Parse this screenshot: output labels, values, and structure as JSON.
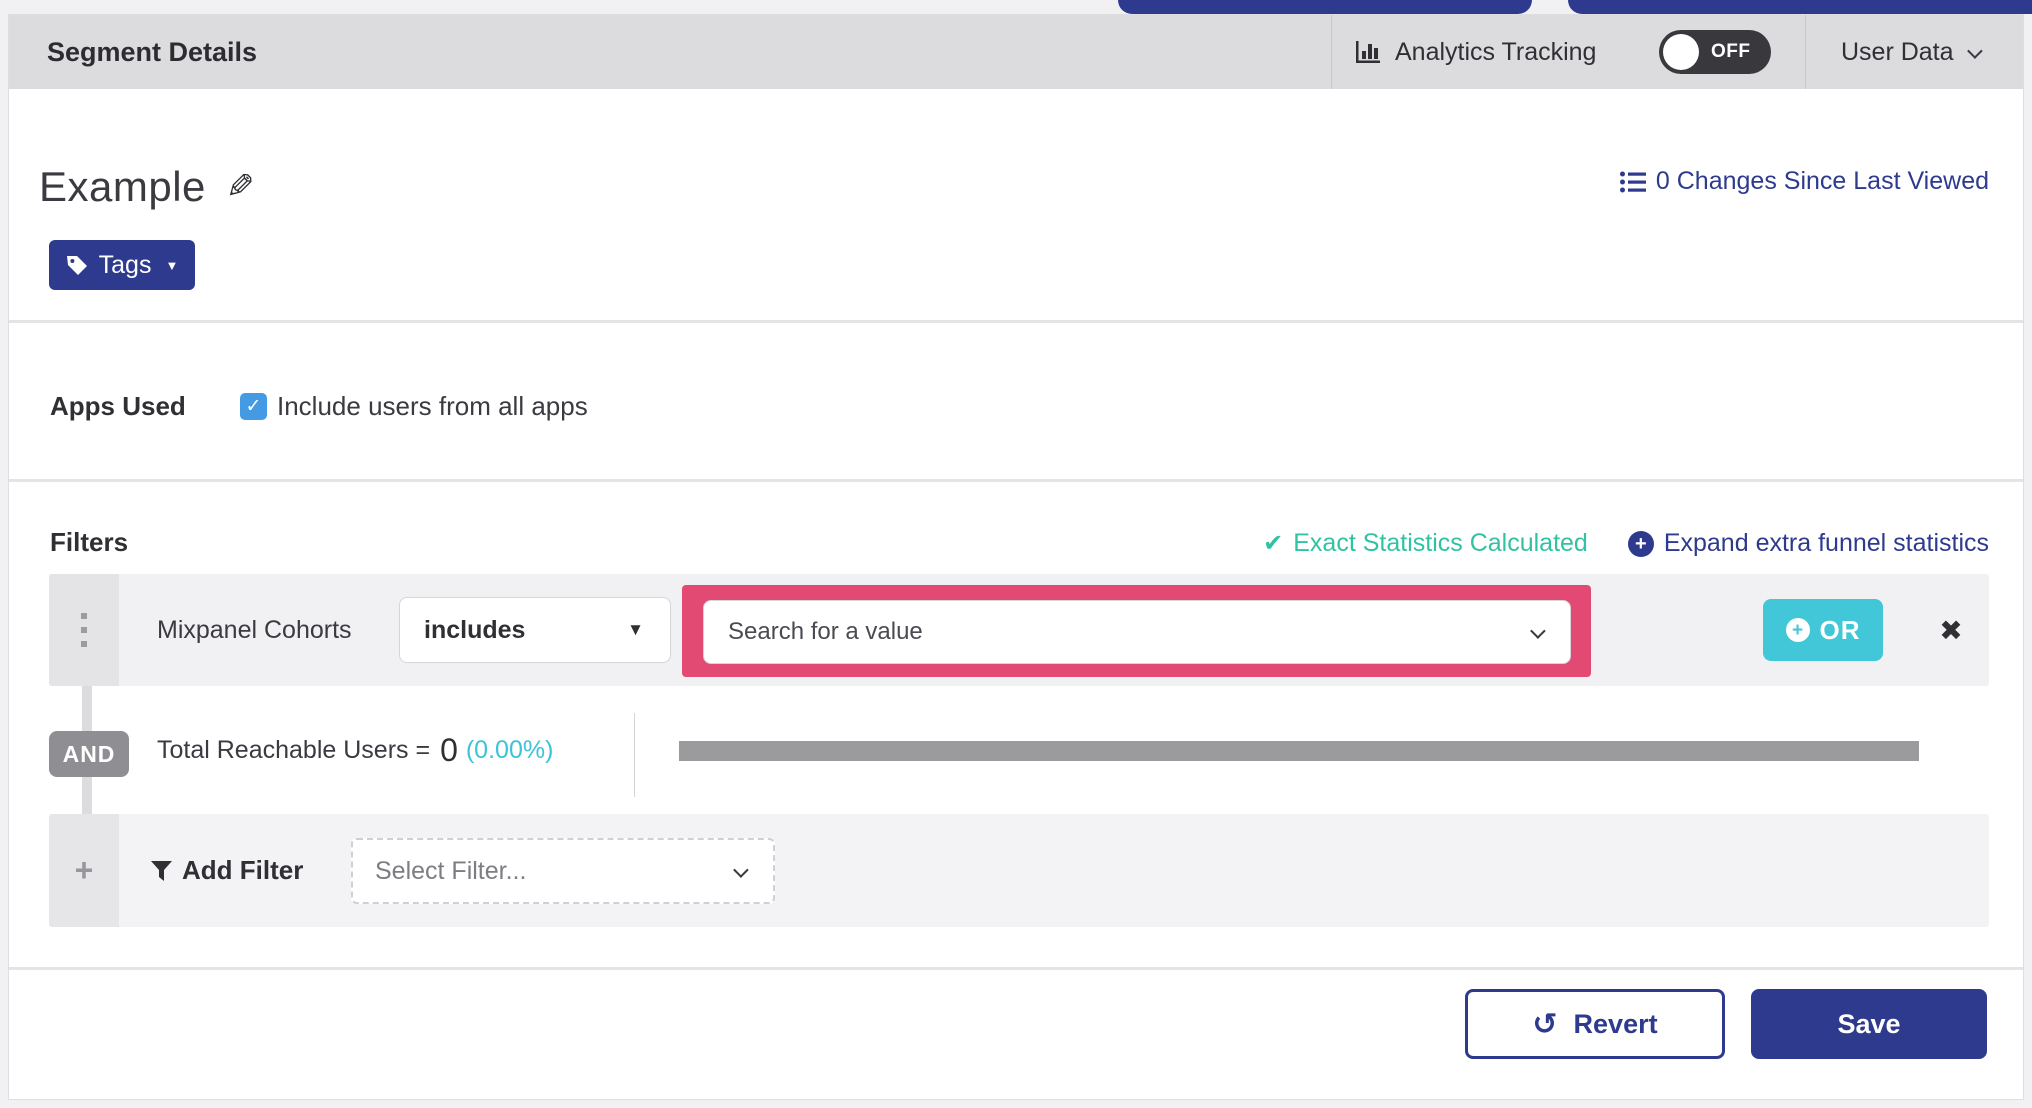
{
  "header": {
    "title": "Segment Details",
    "analytics_tracking_label": "Analytics Tracking",
    "toggle_state": "OFF",
    "user_data_label": "User Data"
  },
  "title_section": {
    "segment_name": "Example",
    "changes_link": "0 Changes Since Last Viewed",
    "tags_label": "Tags"
  },
  "apps_used": {
    "label": "Apps Used",
    "checkbox_label": "Include users from all apps",
    "checked": true
  },
  "filters": {
    "heading": "Filters",
    "exact_stats_label": "Exact Statistics Calculated",
    "expand_link_label": "Expand extra funnel statistics",
    "row1": {
      "filter_name": "Mixpanel Cohorts",
      "operator_value": "includes",
      "value_placeholder": "Search for a value",
      "or_label": "OR",
      "close_glyph": "✖"
    },
    "connector_label": "AND",
    "stats": {
      "label": "Total Reachable Users =",
      "value": "0",
      "percent": "(0.00%)"
    },
    "add_filter": {
      "plus_glyph": "+",
      "label": "Add Filter",
      "select_placeholder": "Select Filter..."
    }
  },
  "footer": {
    "revert_label": "Revert",
    "revert_icon_glyph": "↺",
    "save_label": "Save"
  },
  "glyphs": {
    "pencil": "✎",
    "check": "✓",
    "heavy_check": "✔",
    "solid_caret": "▼",
    "plus": "+"
  },
  "colors": {
    "accent_navy": "#2d3a8e",
    "teal_success": "#2fc3a3",
    "cyan": "#3bc4d8",
    "or_button": "#41c7d8",
    "highlight_pink": "#e24a73",
    "toggle_off_bg": "#39393d",
    "checkbox_blue": "#459ae4",
    "header_bar_bg": "#dcdcdf",
    "progress_gray": "#9b9b9e"
  }
}
